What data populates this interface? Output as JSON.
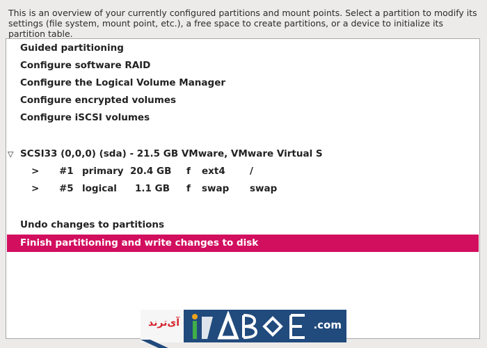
{
  "instructions": "This is an overview of your currently configured partitions and mount points. Select a partition to modify its settings (file system, mount point, etc.), a free space to create partitions, or a device to initialize its partition table.",
  "menu_items": [
    {
      "label": "Guided partitioning"
    },
    {
      "label": "Configure software RAID"
    },
    {
      "label": "Configure the Logical Volume Manager"
    },
    {
      "label": "Configure encrypted volumes"
    },
    {
      "label": "Configure iSCSI volumes"
    }
  ],
  "device": {
    "expander": "▽",
    "label": "SCSI33 (0,0,0) (sda) - 21.5 GB VMware, VMware Virtual S"
  },
  "partitions": [
    {
      "arrow": ">",
      "number": "#1",
      "type": "primary",
      "size": "20.4 GB",
      "flag": "f",
      "fs": "ext4",
      "mount": "/"
    },
    {
      "arrow": ">",
      "number": "#5",
      "type": "logical",
      "size": "1.1 GB",
      "flag": "f",
      "fs": "swap",
      "mount": "swap"
    }
  ],
  "actions": {
    "undo": "Undo changes to partitions",
    "finish": "Finish partitioning and write changes to disk"
  },
  "watermark": {
    "left_text": "آی‌ترند",
    "right_text": ".com"
  },
  "colors": {
    "selection": "#d20e5e",
    "watermark_blue": "#214a7d"
  }
}
